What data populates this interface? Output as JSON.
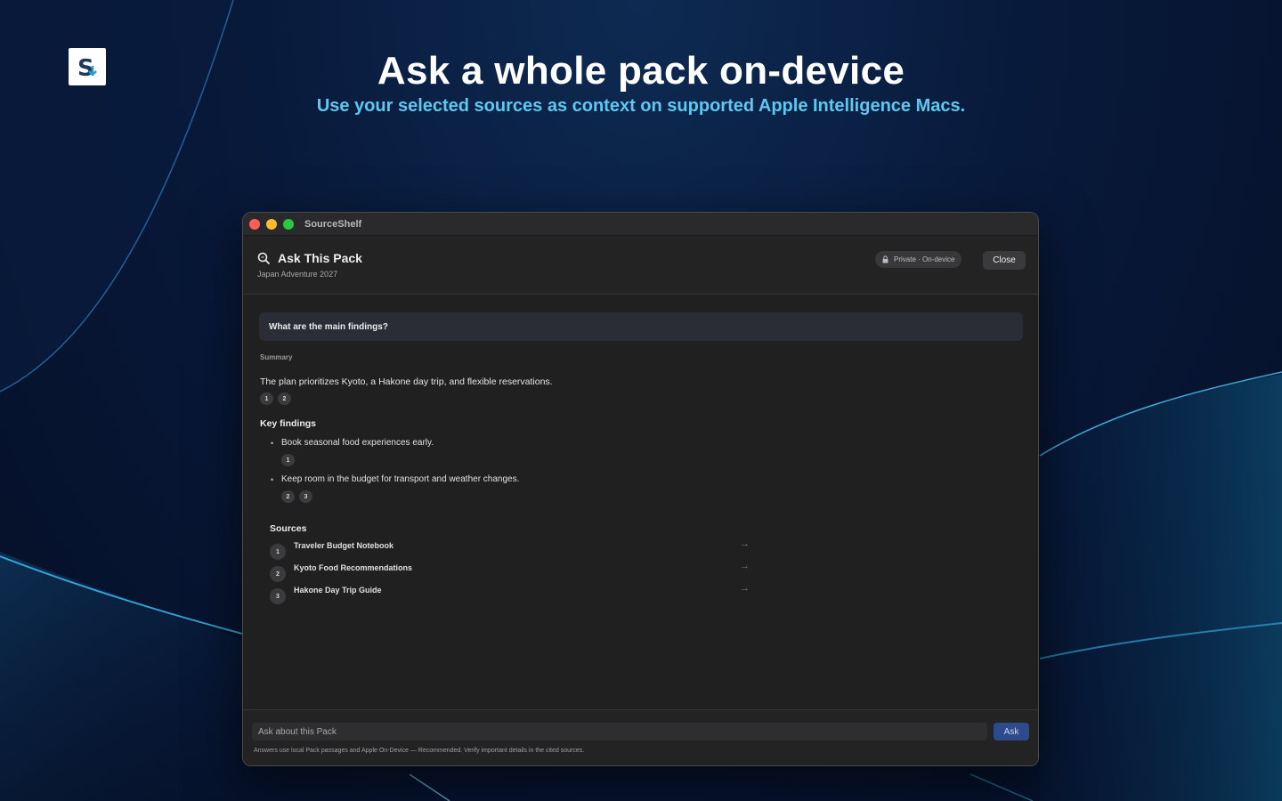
{
  "marketing": {
    "headline": "Ask a whole pack on-device",
    "subhead": "Use your selected sources as context on supported Apple Intelligence Macs.",
    "logo_icon": "sourceshelf-logo-icon",
    "accent_color": "#5ec8f0"
  },
  "window": {
    "app_title": "SourceShelf",
    "header": {
      "title": "Ask This Pack",
      "subtitle": "Japan Adventure 2027",
      "privacy_badge": "Private · On-device",
      "close_label": "Close"
    },
    "question": "What are the main findings?",
    "summary_label": "Summary",
    "summary_text": "The plan prioritizes Kyoto, a Hakone day trip, and flexible reservations.",
    "summary_citations": [
      "1",
      "2"
    ],
    "key_findings_title": "Key findings",
    "findings": [
      {
        "text": "Book seasonal food experiences early.",
        "citations": [
          "1"
        ]
      },
      {
        "text": "Keep room in the budget for transport and weather changes.",
        "citations": [
          "2",
          "3"
        ]
      }
    ],
    "sources_title": "Sources",
    "sources": [
      {
        "num": "1",
        "name": "Traveler Budget Notebook"
      },
      {
        "num": "2",
        "name": "Kyoto Food Recommendations"
      },
      {
        "num": "3",
        "name": "Hakone Day Trip Guide"
      }
    ],
    "footer": {
      "input_placeholder": "Ask about this Pack",
      "ask_label": "Ask",
      "footnote": "Answers use local Pack passages and Apple On-Device — Recommended. Verify important details in the cited sources."
    }
  }
}
